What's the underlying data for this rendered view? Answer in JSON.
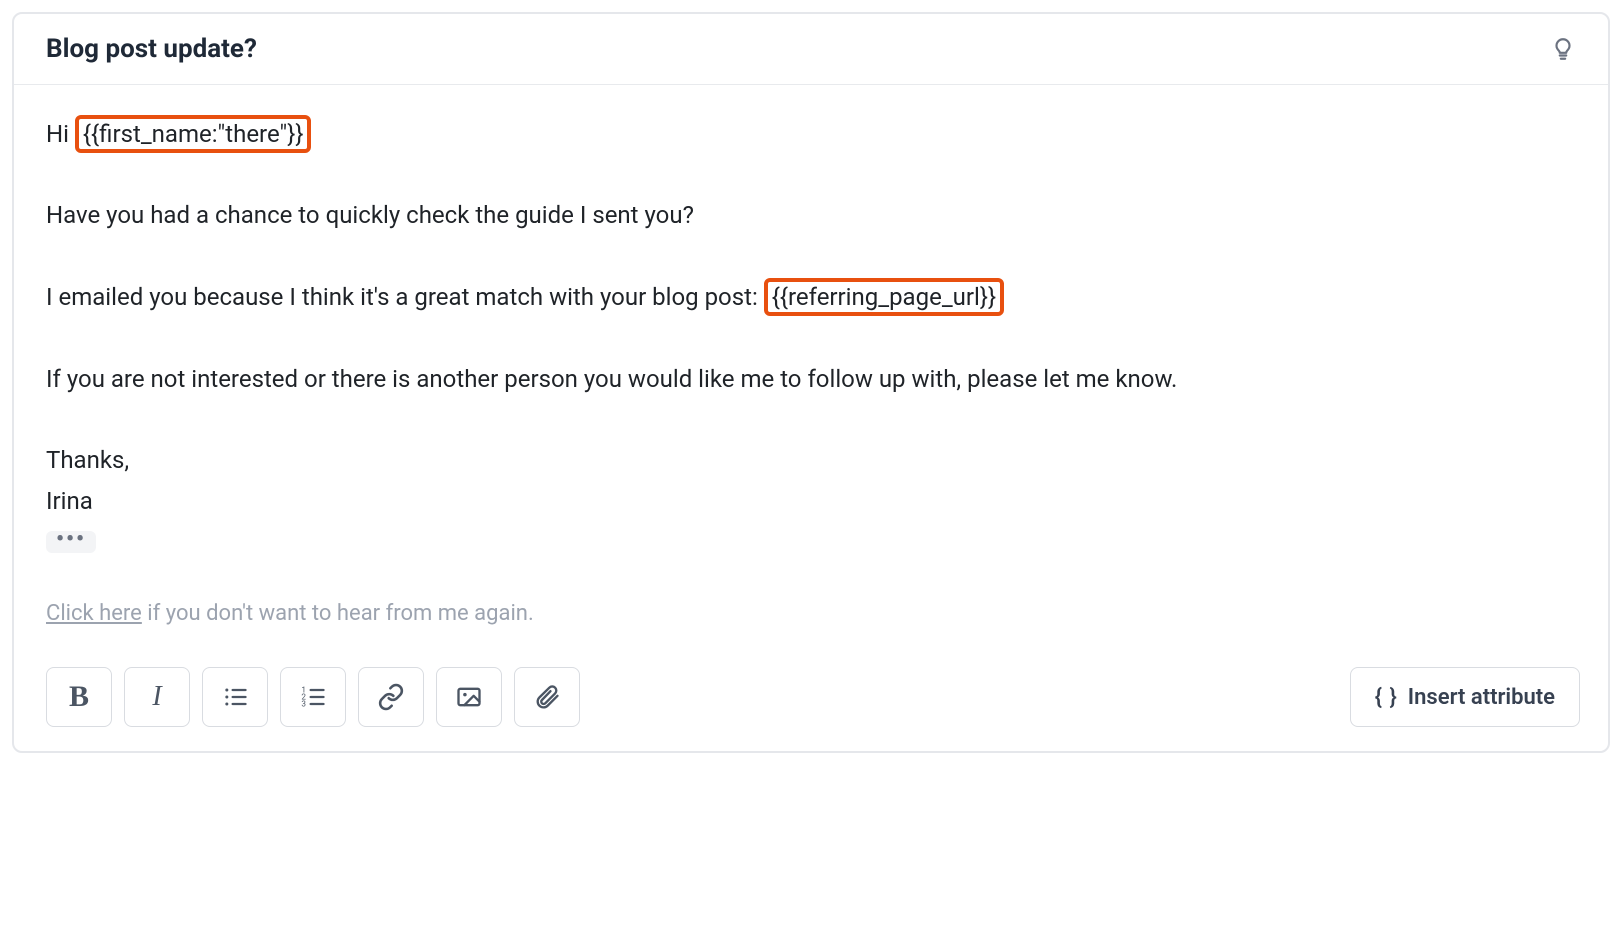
{
  "subject_line": "Blog post update?",
  "body": {
    "greeting_prefix": "Hi ",
    "greeting_attribute": "{{first_name:\"there\"}}",
    "line2": "Have you had a chance to quickly check the guide I sent you?",
    "line3_prefix": "I emailed you because I think it's a great match with your blog post: ",
    "line3_attribute": "{{referring_page_url}}",
    "line4": "If you are not interested or there is another person you would like me to follow up with, please let me know.",
    "signoff": "Thanks,",
    "signature": "Irina"
  },
  "unsubscribe": {
    "link_text": "Click here",
    "rest": " if you don't want to hear from me again."
  },
  "toolbar": {
    "insert_attribute_label": "Insert attribute"
  }
}
